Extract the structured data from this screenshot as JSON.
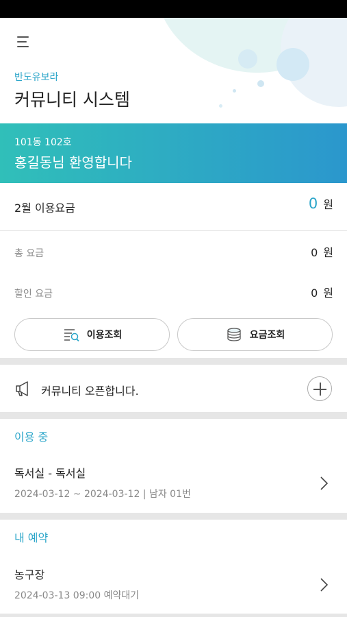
{
  "header": {
    "complex_name": "반도유보라",
    "system_title": "커뮤니티 시스템"
  },
  "welcome": {
    "unit": "101동 102호",
    "greeting": "홍길동님 환영합니다"
  },
  "fees": {
    "monthly_label": "2월 이용요금",
    "monthly_amount": "0",
    "currency": "원",
    "total_label": "총 요금",
    "total_amount": "0",
    "discount_label": "할인 요금",
    "discount_amount": "0"
  },
  "buttons": {
    "usage_lookup": "이용조회",
    "fee_lookup": "요금조회"
  },
  "notice": {
    "text": "커뮤니티 오픈합니다."
  },
  "in_use": {
    "heading": "이용 중",
    "title": "독서실 - 독서실",
    "detail": "2024-03-12 ~ 2024-03-12 | 남자 01번"
  },
  "reservation": {
    "heading": "내 예약",
    "title": "농구장",
    "detail": "2024-03-13 09:00 예약대기"
  },
  "colors": {
    "accent": "#2aa5c9",
    "gradient_start": "#30bfb9",
    "gradient_end": "#2b97cd"
  }
}
